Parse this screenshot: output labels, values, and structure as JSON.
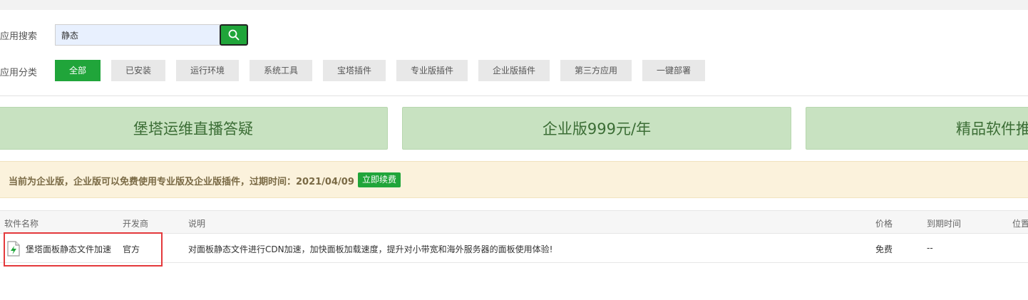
{
  "search": {
    "label": "应用搜索",
    "value": "静态"
  },
  "categories": {
    "label": "应用分类",
    "items": [
      "全部",
      "已安装",
      "运行环境",
      "系统工具",
      "宝塔插件",
      "专业版插件",
      "企业版插件",
      "第三方应用",
      "一键部署"
    ],
    "active_index": 0
  },
  "banners": [
    "堡塔运维直播答疑",
    "企业版999元/年",
    "精品软件推"
  ],
  "notice": {
    "text": "当前为企业版，企业版可以免费使用专业版及企业版插件，过期时间：2021/04/09",
    "button": "立即续费"
  },
  "table": {
    "columns": [
      "软件名称",
      "开发商",
      "说明",
      "价格",
      "到期时间",
      "位置"
    ],
    "rows": [
      {
        "name": "堡塔面板静态文件加速",
        "developer": "官方",
        "description": "对面板静态文件进行CDN加速，加快面板加载速度，提升对小带宽和海外服务器的面板使用体验!",
        "price": "免费",
        "expire": "--"
      }
    ]
  },
  "colors": {
    "accent": "#20a53a",
    "banner_bg": "#c8e2c1",
    "notice_bg": "#fbf2dc",
    "highlight": "#e4393c"
  }
}
